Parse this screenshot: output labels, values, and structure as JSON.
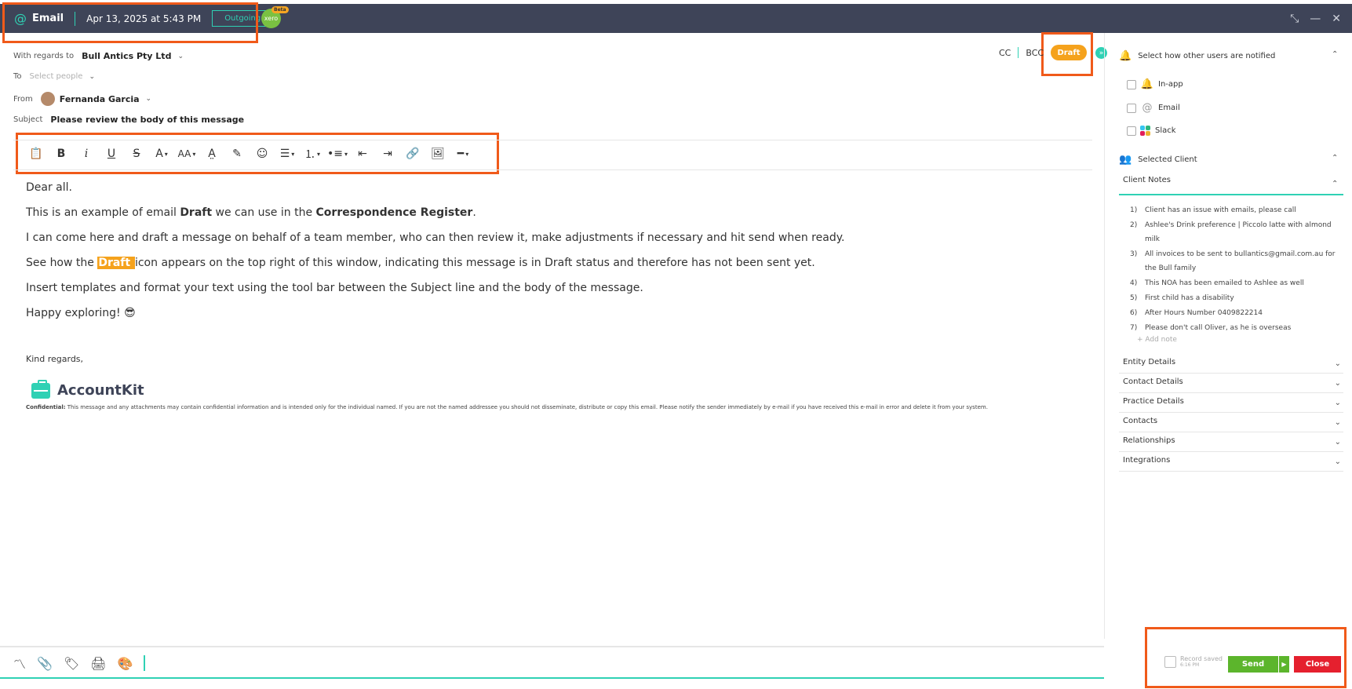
{
  "titlebar": {
    "at_icon": "@",
    "title": "Email",
    "date": "Apr 13, 2025 at 5:43 PM",
    "direction_badge": "Outgoing",
    "xero_label": "xero",
    "beta_label": "Beta"
  },
  "header": {
    "regards_label": "With regards to",
    "regards_value": "Bull Antics Pty Ltd",
    "to_label": "To",
    "to_placeholder": "Select people",
    "from_label": "From",
    "from_value": "Fernanda Garcia",
    "subject_label": "Subject",
    "subject_value": "Please review the body of this message",
    "cc_label": "CC",
    "bcc_label": "BCC",
    "status_badge": "Draft"
  },
  "toolbar": {
    "bold": "B",
    "italic": "i",
    "underline": "U",
    "strike": "S",
    "font_color": "A",
    "font_size": "AA"
  },
  "body": {
    "greeting": "Dear all.",
    "p1_a": "This is an example of email ",
    "p1_b": "Draft",
    "p1_c": " we can use in the ",
    "p1_d": "Correspondence Register",
    "p1_e": ".",
    "p2": "I can come here and draft a message on behalf of a team member, who can then review it, make adjustments if necessary and hit send when ready.",
    "p3_a": "See how the ",
    "p3_b": "Draft ",
    "p3_c": " icon appears on the top right of this window, indicating this message is in Draft status and therefore has not been sent yet.",
    "p4": "Insert templates and format your text using the tool bar between the Subject line and the body of the message.",
    "p5": "Happy exploring! 😎",
    "kind_regards": "Kind regards,",
    "logo_text": "AccountKit",
    "confidential_label": "Confidential:",
    "confidential_text": " This message and any attachments may contain confidential information and is intended only for the individual named. If you are not the named addressee you should not disseminate, distribute or copy this email. Please notify the sender immediately by e-mail if you have received this e-mail in error and delete it from your system."
  },
  "panel": {
    "notify_heading": "Select how other users are notified",
    "notify_options": [
      "In-app",
      "Email",
      "Slack"
    ],
    "selected_client_heading": "Selected Client",
    "client_notes_heading": "Client Notes",
    "notes": [
      {
        "n": "1)",
        "text": "Client has an issue with emails, please call"
      },
      {
        "n": "2)",
        "text": "Ashlee's Drink preference | Piccolo latte with almond milk"
      },
      {
        "n": "3)",
        "text": "All invoices to be sent to bullantics@gmail.com.au for the Bull family"
      },
      {
        "n": "4)",
        "text": "This NOA has been emailed to Ashlee as well"
      },
      {
        "n": "5)",
        "text": "First child has a disability"
      },
      {
        "n": "6)",
        "text": "After Hours Number 0409822214"
      },
      {
        "n": "7)",
        "text": "Please don't call Oliver, as he is overseas"
      }
    ],
    "add_note": "+ Add note",
    "accordions": [
      "Entity Details",
      "Contact Details",
      "Practice Details",
      "Contacts",
      "Relationships",
      "Integrations"
    ]
  },
  "footer": {
    "saved_title": "Record saved",
    "saved_time": "6:16 PM",
    "send_label": "Send",
    "close_label": "Close"
  }
}
